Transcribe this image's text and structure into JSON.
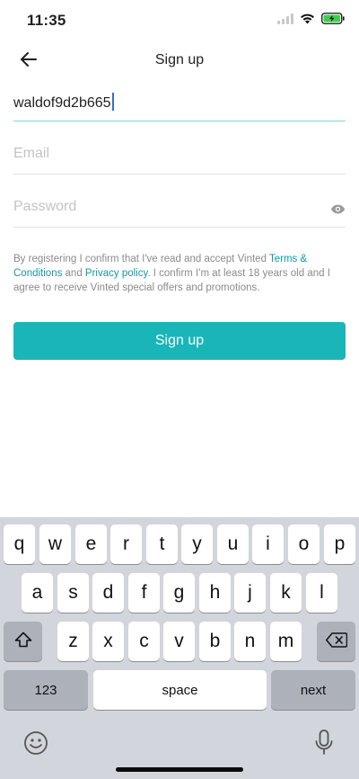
{
  "status_bar": {
    "time": "11:35"
  },
  "nav": {
    "title": "Sign up"
  },
  "form": {
    "username_value": "waldof9d2b665",
    "email_placeholder": "Email",
    "password_placeholder": "Password"
  },
  "terms": {
    "text_1": "By registering I confirm that I've read and accept Vinted ",
    "terms_link": "Terms & Conditions",
    "text_2": " and ",
    "privacy_link": "Privacy policy",
    "text_3": ". I confirm I'm at least 18 years old and I agree to receive Vinted special offers and promotions."
  },
  "primary_button": {
    "label": "Sign up"
  },
  "keyboard": {
    "row1": [
      "q",
      "w",
      "e",
      "r",
      "t",
      "y",
      "u",
      "i",
      "o",
      "p"
    ],
    "row2": [
      "a",
      "s",
      "d",
      "f",
      "g",
      "h",
      "j",
      "k",
      "l"
    ],
    "row3": [
      "z",
      "x",
      "c",
      "v",
      "b",
      "n",
      "m"
    ],
    "numbers_key": "123",
    "space_key": "space",
    "next_key": "next"
  },
  "colors": {
    "accent": "#19b5b9",
    "link": "#109aa6",
    "keyboard_bg": "#d2d5db"
  }
}
